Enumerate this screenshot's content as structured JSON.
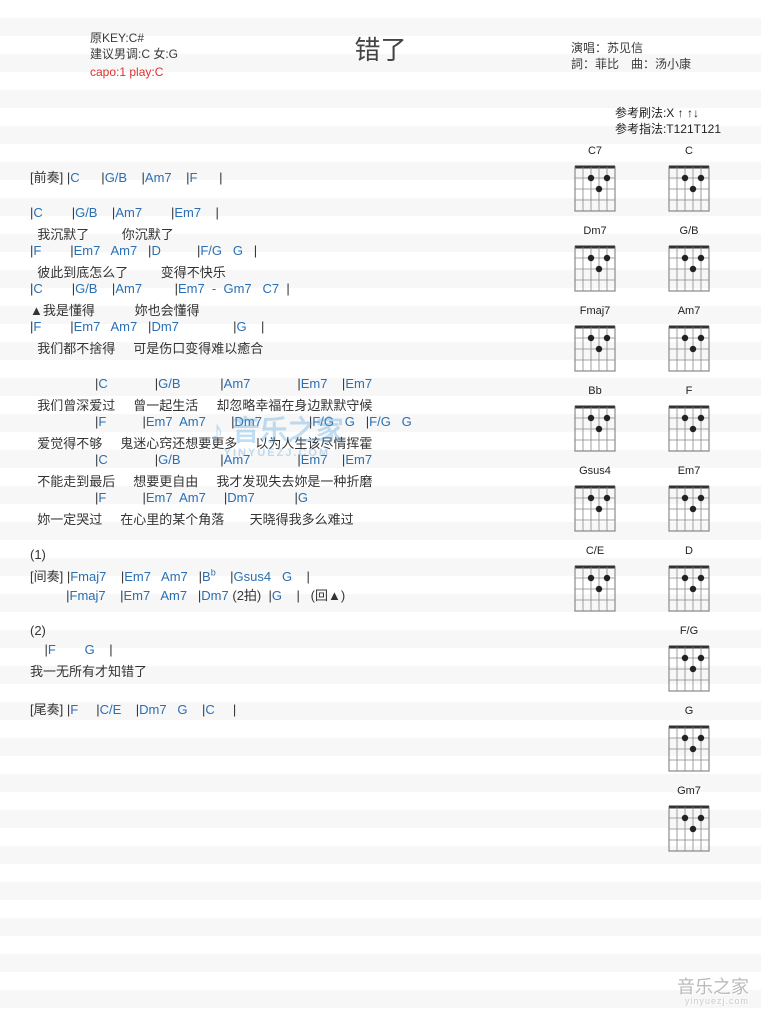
{
  "title": "错了",
  "meta_left": {
    "orig_key": "原KEY:C#",
    "suggest": "建议男调:C 女:G",
    "capo": "capo:1 play:C"
  },
  "meta_right": {
    "singer": "演唱：苏见信",
    "lyric_comp": "詞：菲比　曲：汤小康"
  },
  "reference": {
    "strum": "参考刷法:X ↑ ↑↓",
    "pick": "参考指法:T121T121"
  },
  "lines": [
    {
      "type": "chord",
      "text": "[前奏] |C      |G/B    |Am7    |F      |",
      "section": "[前奏] "
    },
    {
      "type": "spacer"
    },
    {
      "type": "chord",
      "text": "|C        |G/B    |Am7        |Em7    |"
    },
    {
      "type": "lyric",
      "text": "  我沉默了         你沉默了"
    },
    {
      "type": "chord",
      "text": "|F        |Em7   Am7   |D          |F/G   G   |"
    },
    {
      "type": "lyric",
      "text": "  彼此到底怎么了         变得不快乐"
    },
    {
      "type": "chord",
      "text": "|C        |G/B    |Am7         |Em7  -  Gm7   C7  |"
    },
    {
      "type": "lyric",
      "text": "▲我是懂得           妳也会懂得"
    },
    {
      "type": "chord",
      "text": "|F        |Em7   Am7   |Dm7               |G    |"
    },
    {
      "type": "lyric",
      "text": "  我们都不捨得     可是伤口变得难以癒合"
    },
    {
      "type": "spacer"
    },
    {
      "type": "chord",
      "text": "                  |C             |G/B           |Am7             |Em7    |Em7   "
    },
    {
      "type": "lyric",
      "text": "  我们曾深爱过     曾一起生活     却忽略幸福在身边默默守候"
    },
    {
      "type": "chord",
      "text": "                  |F          |Em7  Am7       |Dm7             |F/G   G   |F/G   G   "
    },
    {
      "type": "lyric",
      "text": "  爱觉得不够     鬼迷心窍还想要更多     以为人生该尽情挥霍"
    },
    {
      "type": "chord",
      "text": "                  |C             |G/B           |Am7             |Em7    |Em7   "
    },
    {
      "type": "lyric",
      "text": "  不能走到最后     想要更自由     我才发现失去妳是一种折磨"
    },
    {
      "type": "chord",
      "text": "                  |F          |Em7  Am7     |Dm7           |G    "
    },
    {
      "type": "lyric",
      "text": "  妳一定哭过     在心里的某个角落       天晓得我多么难过"
    },
    {
      "type": "spacer"
    },
    {
      "type": "lyric",
      "text": "(1)"
    },
    {
      "type": "chord",
      "text": "[间奏] |Fmaj7    |Em7   Am7   |B♭    |Gsus4   G    |",
      "section": "[间奏] "
    },
    {
      "type": "chord",
      "text": "          |Fmaj7    |Em7   Am7   |Dm7 (2拍)  |G    |   (回▲)",
      "mixed": true
    },
    {
      "type": "spacer"
    },
    {
      "type": "lyric",
      "text": "(2)"
    },
    {
      "type": "chord",
      "text": "    |F        G    |"
    },
    {
      "type": "lyric",
      "text": "我一无所有才知错了"
    },
    {
      "type": "spacer"
    },
    {
      "type": "chord",
      "text": "[尾奏] |F     |C/E    |Dm7   G    |C     |",
      "section": "[尾奏] "
    }
  ],
  "chord_diagrams": [
    [
      "C7",
      "C"
    ],
    [
      "Dm7",
      "G/B"
    ],
    [
      "Fmaj7",
      "Am7"
    ],
    [
      "Bb",
      "F"
    ],
    [
      "Gsus4",
      "Em7"
    ],
    [
      "C/E",
      "D"
    ],
    [
      null,
      "F/G"
    ],
    [
      null,
      "G"
    ],
    [
      null,
      "Gm7"
    ]
  ],
  "watermark": {
    "big": "音乐之家",
    "small": "YINYUEZJ.COM"
  },
  "corner": {
    "big": "音乐之家",
    "small": "yinyuezj.com"
  }
}
